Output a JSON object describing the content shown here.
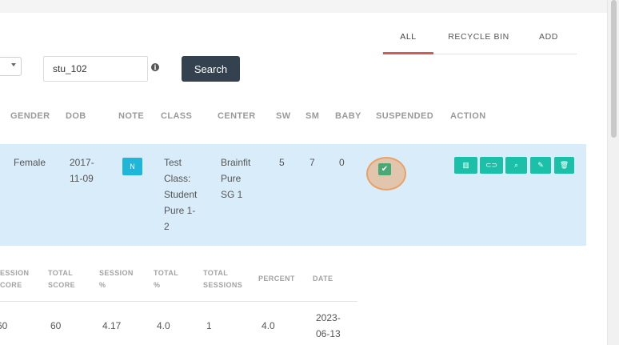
{
  "tabs": [
    {
      "label": "ALL",
      "active": true
    },
    {
      "label": "RECYCLE BIN",
      "active": false
    },
    {
      "label": "ADD",
      "active": false
    }
  ],
  "search": {
    "value": "stu_102",
    "button_label": "Search",
    "info_icon": "info-icon",
    "info_glyph": "i"
  },
  "table": {
    "headers": [
      "GENDER",
      "DOB",
      "NOTE",
      "CLASS",
      "CENTER",
      "SW",
      "SM",
      "BABY",
      "SUSPENDED",
      "ACTION"
    ],
    "row": {
      "gender": "Female",
      "dob": [
        "2017-",
        "11-09"
      ],
      "note_badge": "N",
      "class": [
        "Test",
        "Class:",
        "Student",
        "Pure 1-",
        "2"
      ],
      "center": [
        "Brainfit",
        "Pure",
        "SG 1"
      ],
      "sw": "5",
      "sm": "7",
      "baby": "0",
      "suspended": true,
      "suspended_glyph": "✔",
      "actions": [
        {
          "icon": "bar-chart-icon",
          "glyph": "▥"
        },
        {
          "icon": "link-icon",
          "glyph": "⊂⊃"
        },
        {
          "icon": "search-icon",
          "glyph": "⌕"
        },
        {
          "icon": "edit-icon",
          "glyph": "✎"
        },
        {
          "icon": "trash-icon",
          "glyph": "🗑"
        }
      ]
    }
  },
  "sessions": {
    "headers": [
      [
        "ESSION",
        "CORE"
      ],
      [
        "TOTAL",
        "SCORE"
      ],
      [
        "SESSION",
        "%"
      ],
      [
        "TOTAL",
        "%"
      ],
      [
        "TOTAL",
        "SESSIONS"
      ],
      [
        "PERCENT"
      ],
      [
        "DATE"
      ]
    ],
    "row": [
      "60",
      "60",
      "4.17",
      "4.0",
      "1",
      "4.0",
      [
        "2023-",
        "06-13"
      ]
    ]
  },
  "colors": {
    "active_tab_underline": "#d45a5a",
    "search_button": "#344250",
    "row_highlight": "#d9ecf9",
    "note_badge": "#1fb6d9",
    "action_button": "#1cbfa8",
    "suspended_check": "#4aa874"
  }
}
